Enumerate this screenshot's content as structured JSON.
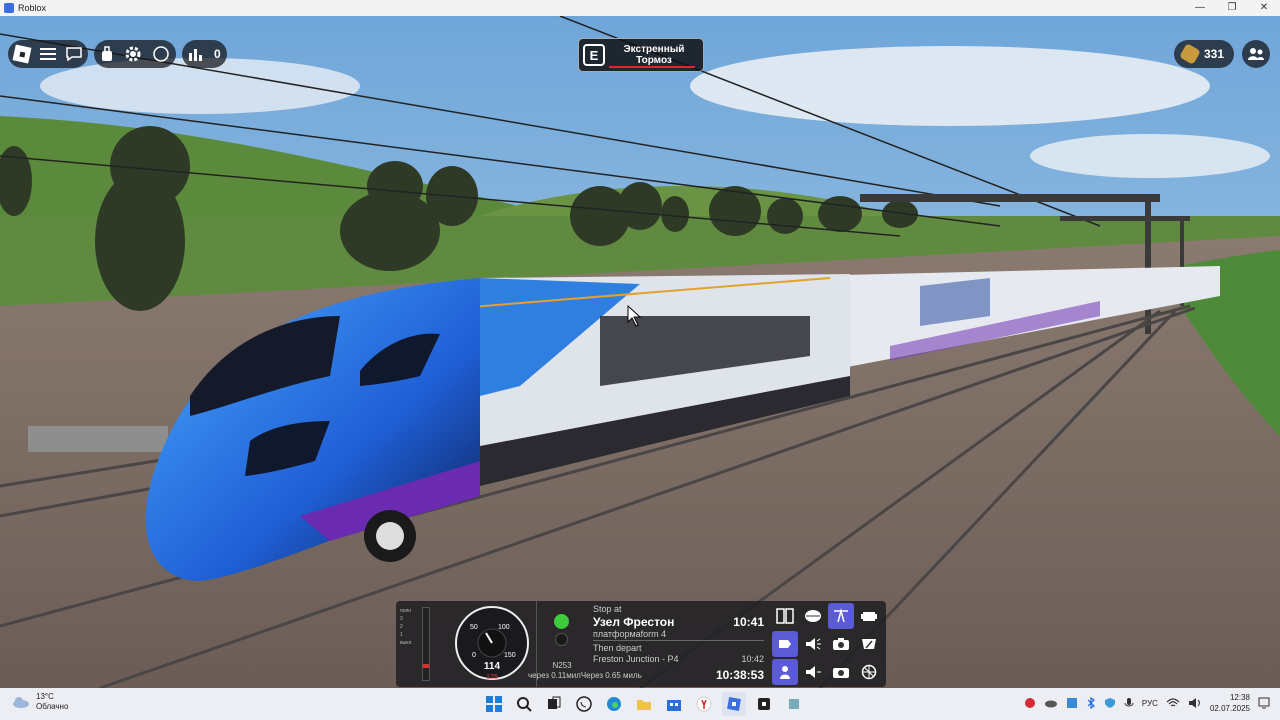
{
  "window": {
    "title": "Roblox",
    "controls": [
      "—",
      "❐",
      "✕"
    ]
  },
  "hud": {
    "chat_count": "0",
    "emergency_brake": {
      "key": "E",
      "label_line1": "Экстренный",
      "label_line2": "Тормоз"
    },
    "currency": "331"
  },
  "panel": {
    "gauge": {
      "scale_labels": [
        "0",
        "50",
        "100",
        "150"
      ],
      "speed": "114",
      "limit": "125"
    },
    "notch_labels": [
      "полн",
      "3",
      "2",
      "1",
      "выкл"
    ],
    "signal": {
      "id": "N253",
      "state_color": "#3ccc3c"
    },
    "stop": {
      "header": "Stop at",
      "station": "Узел Фрестон",
      "platform": "платформаform 4",
      "arrival_time": "10:41",
      "then_label": "Then depart",
      "next_stop": "Freston Junction - P4",
      "next_time": "10:42",
      "distance_label": "через 0.11милЧерез 0.65 миль",
      "clock": "10:38:53"
    }
  },
  "taskbar": {
    "weather_temp": "13°C",
    "weather_desc": "Облачно",
    "language": "РУС",
    "time": "12:38",
    "date": "02.07.2025"
  }
}
